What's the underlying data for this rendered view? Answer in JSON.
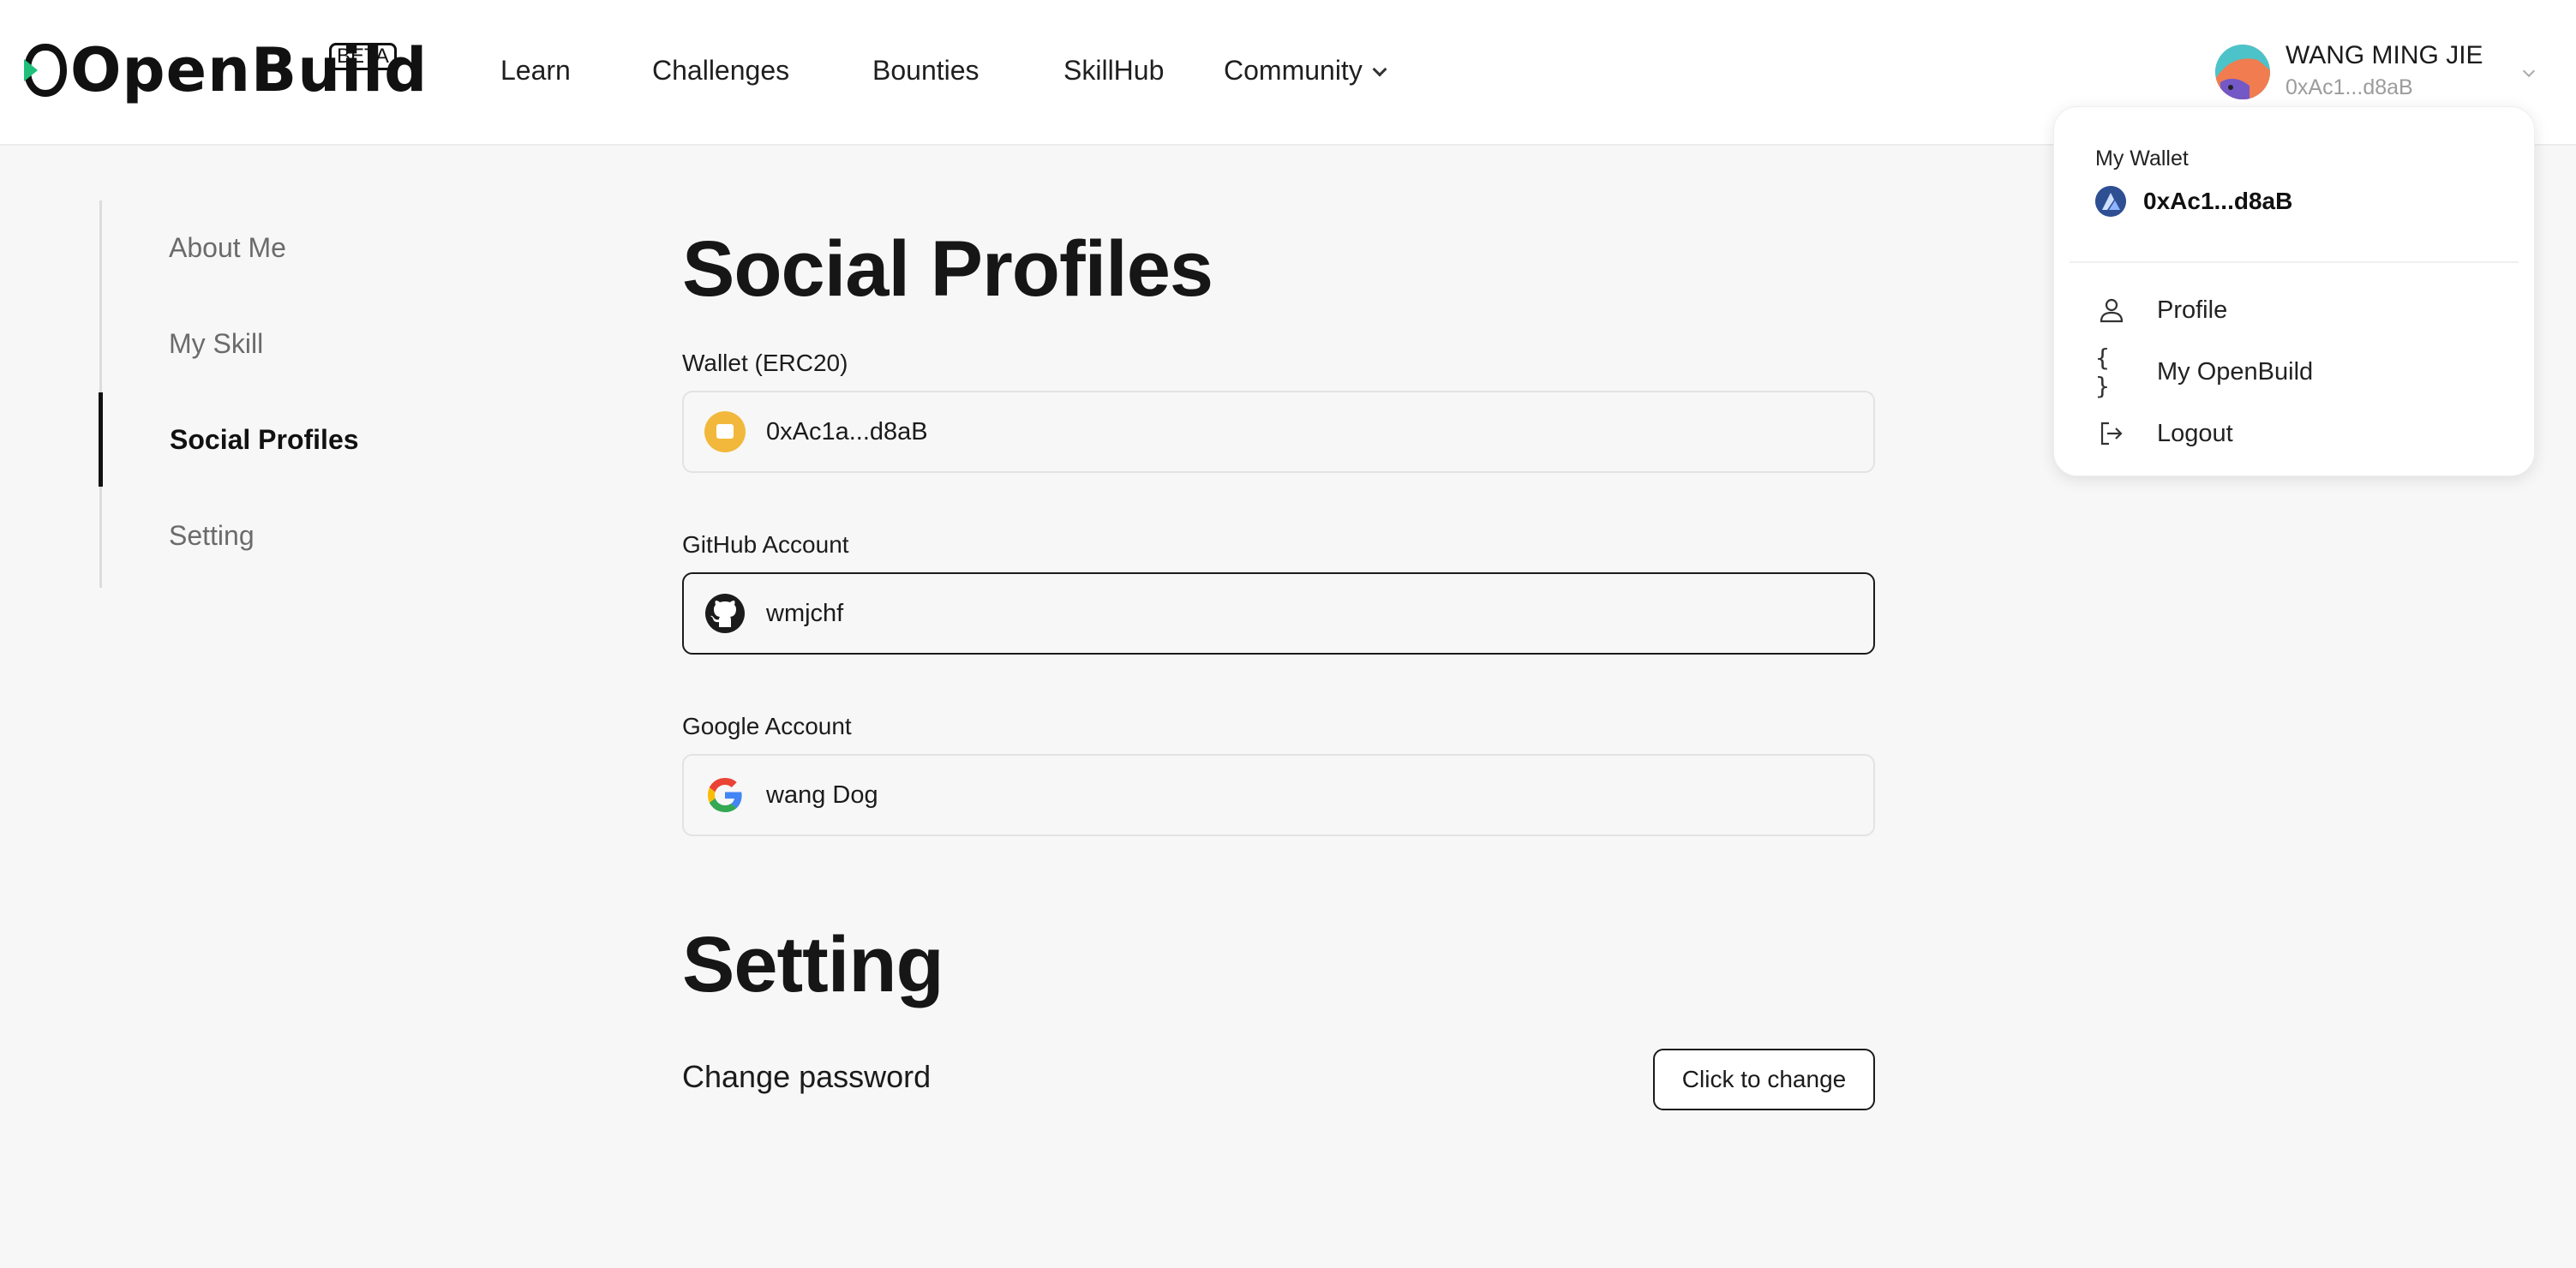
{
  "header": {
    "brand": "OpenBuild",
    "beta_badge": "BETA",
    "nav": [
      {
        "label": "Learn"
      },
      {
        "label": "Challenges"
      },
      {
        "label": "Bounties"
      },
      {
        "label": "SkillHub"
      },
      {
        "label": "Community"
      }
    ],
    "user": {
      "name": "WANG MING JIE",
      "address": "0xAc1...d8aB"
    }
  },
  "dropdown": {
    "wallet_label": "My Wallet",
    "wallet_address": "0xAc1...d8aB",
    "items": [
      {
        "label": "Profile",
        "icon": "user-icon"
      },
      {
        "label": "My OpenBuild",
        "icon": "braces-icon"
      },
      {
        "label": "Logout",
        "icon": "logout-icon"
      }
    ]
  },
  "sidebar": {
    "items": [
      {
        "label": "About Me"
      },
      {
        "label": "My Skill"
      },
      {
        "label": "Social Profiles",
        "active": true
      },
      {
        "label": "Setting"
      }
    ]
  },
  "social": {
    "title": "Social Profiles",
    "wallet": {
      "label": "Wallet (ERC20)",
      "value": "0xAc1a...d8aB",
      "icon": "wallet-icon"
    },
    "github": {
      "label": "GitHub Account",
      "value": "wmjchf",
      "icon": "github-icon"
    },
    "google": {
      "label": "Google Account",
      "value": "wang Dog",
      "icon": "google-icon"
    }
  },
  "setting": {
    "title": "Setting",
    "change_password_label": "Change password",
    "change_button": "Click to change"
  },
  "colors": {
    "page_bg": "#f7f7f7",
    "header_bg": "#ffffff",
    "wallet_icon": "#f2b83c",
    "accent": "#111111"
  }
}
